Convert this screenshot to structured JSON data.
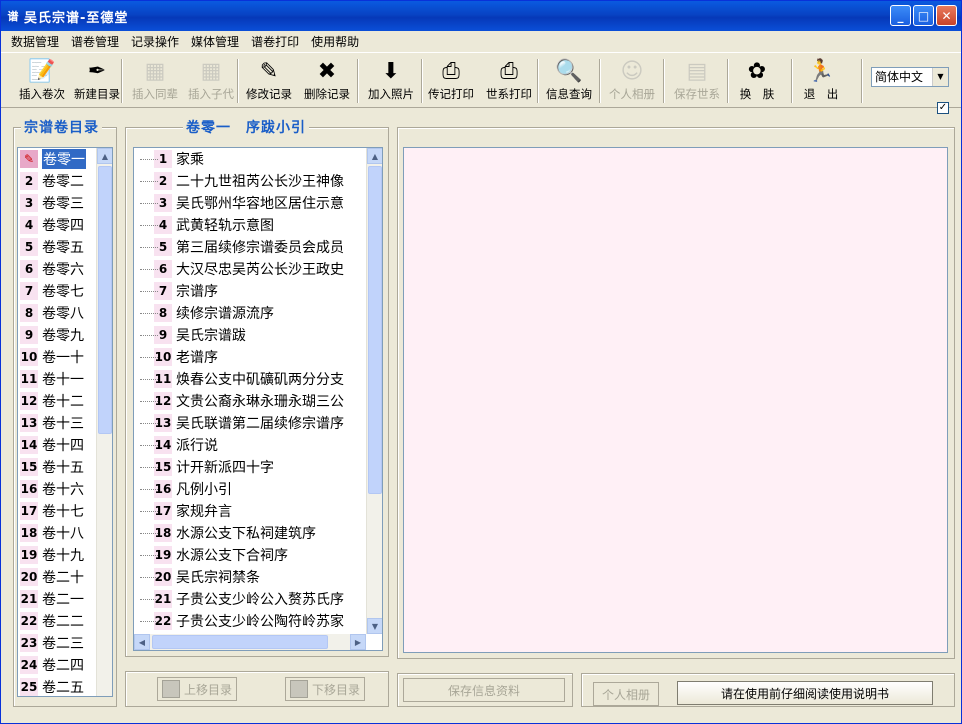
{
  "window": {
    "title": "吴氏宗谱-至德堂",
    "app_icon": "谱"
  },
  "menu": [
    "数据管理",
    "谱卷管理",
    "记录操作",
    "媒体管理",
    "谱卷打印",
    "使用帮助"
  ],
  "toolbar": [
    {
      "label": "插入卷次",
      "icon": "insert-volume-icon",
      "glyph": "📝",
      "enabled": true
    },
    {
      "label": "新建目录",
      "icon": "new-catalog-icon",
      "glyph": "✒",
      "enabled": true
    },
    {
      "label": "插入同辈",
      "icon": "insert-sibling-icon",
      "glyph": "▦",
      "enabled": false
    },
    {
      "label": "插入子代",
      "icon": "insert-child-icon",
      "glyph": "▦",
      "enabled": false
    },
    {
      "label": "修改记录",
      "icon": "edit-record-icon",
      "glyph": "✎",
      "enabled": true
    },
    {
      "label": "删除记录",
      "icon": "delete-record-icon",
      "glyph": "✖",
      "enabled": true
    },
    {
      "label": "加入照片",
      "icon": "add-photo-icon",
      "glyph": "⬇",
      "enabled": true
    },
    {
      "label": "传记打印",
      "icon": "biography-print-icon",
      "glyph": "⎙",
      "enabled": true
    },
    {
      "label": "世系打印",
      "icon": "lineage-print-icon",
      "glyph": "⎙",
      "enabled": true
    },
    {
      "label": "信息查询",
      "icon": "search-info-icon",
      "glyph": "🔍",
      "enabled": true
    },
    {
      "label": "个人相册",
      "icon": "personal-album-icon",
      "glyph": "☺",
      "enabled": false
    },
    {
      "label": "保存世系",
      "icon": "save-lineage-icon",
      "glyph": "▤",
      "enabled": false
    },
    {
      "label": "换　肤",
      "icon": "change-skin-icon",
      "glyph": "✿",
      "enabled": true
    },
    {
      "label": "退　出",
      "icon": "exit-icon",
      "glyph": "🏃",
      "enabled": true
    }
  ],
  "language": {
    "selected": "简体中文"
  },
  "catalog": {
    "title": "宗谱卷目录",
    "items": [
      {
        "num": "",
        "label": "卷零一",
        "selected": true
      },
      {
        "num": "2",
        "label": "卷零二"
      },
      {
        "num": "3",
        "label": "卷零三"
      },
      {
        "num": "4",
        "label": "卷零四"
      },
      {
        "num": "5",
        "label": "卷零五"
      },
      {
        "num": "6",
        "label": "卷零六"
      },
      {
        "num": "7",
        "label": "卷零七"
      },
      {
        "num": "8",
        "label": "卷零八"
      },
      {
        "num": "9",
        "label": "卷零九"
      },
      {
        "num": "10",
        "label": "卷一十"
      },
      {
        "num": "11",
        "label": "卷十一"
      },
      {
        "num": "12",
        "label": "卷十二"
      },
      {
        "num": "13",
        "label": "卷十三"
      },
      {
        "num": "14",
        "label": "卷十四"
      },
      {
        "num": "15",
        "label": "卷十五"
      },
      {
        "num": "16",
        "label": "卷十六"
      },
      {
        "num": "17",
        "label": "卷十七"
      },
      {
        "num": "18",
        "label": "卷十八"
      },
      {
        "num": "19",
        "label": "卷十九"
      },
      {
        "num": "20",
        "label": "卷二十"
      },
      {
        "num": "21",
        "label": "卷二一"
      },
      {
        "num": "22",
        "label": "卷二二"
      },
      {
        "num": "23",
        "label": "卷二三"
      },
      {
        "num": "24",
        "label": "卷二四"
      },
      {
        "num": "25",
        "label": "卷二五"
      }
    ]
  },
  "volume": {
    "title": "卷零一　序跋小引",
    "items": [
      {
        "num": "1",
        "label": "家乘"
      },
      {
        "num": "2",
        "label": "二十九世祖芮公长沙王神像"
      },
      {
        "num": "3",
        "label": "吴氏鄂州华容地区居住示意"
      },
      {
        "num": "4",
        "label": "武黄轻轨示意图"
      },
      {
        "num": "5",
        "label": "第三届续修宗谱委员会成员"
      },
      {
        "num": "6",
        "label": "大汉尽忠吴芮公长沙王政史"
      },
      {
        "num": "7",
        "label": "宗谱序"
      },
      {
        "num": "8",
        "label": "续修宗谱源流序"
      },
      {
        "num": "9",
        "label": "吴氏宗谱跋"
      },
      {
        "num": "10",
        "label": "老谱序"
      },
      {
        "num": "11",
        "label": "焕春公支中矶礦矶两分分支"
      },
      {
        "num": "12",
        "label": "文贵公裔永琳永珊永瑚三公"
      },
      {
        "num": "13",
        "label": "吴氏联谱第二届续修宗谱序"
      },
      {
        "num": "14",
        "label": "派行说"
      },
      {
        "num": "15",
        "label": "计开新派四十字"
      },
      {
        "num": "16",
        "label": "凡例小引"
      },
      {
        "num": "17",
        "label": "家规弁言"
      },
      {
        "num": "18",
        "label": "水源公支下私祠建筑序"
      },
      {
        "num": "19",
        "label": "水源公支下合祠序"
      },
      {
        "num": "20",
        "label": "吴氏宗祠禁条"
      },
      {
        "num": "21",
        "label": "子贵公支少岭公入赘苏氏序"
      },
      {
        "num": "22",
        "label": "子贵公支少岭公陶符岭苏家"
      }
    ]
  },
  "buttons": {
    "move_up": "上移目录",
    "move_down": "下移目录",
    "save_info": "保存信息资料",
    "album": "个人相册",
    "manual": "请在使用前仔细阅读使用说明书"
  }
}
